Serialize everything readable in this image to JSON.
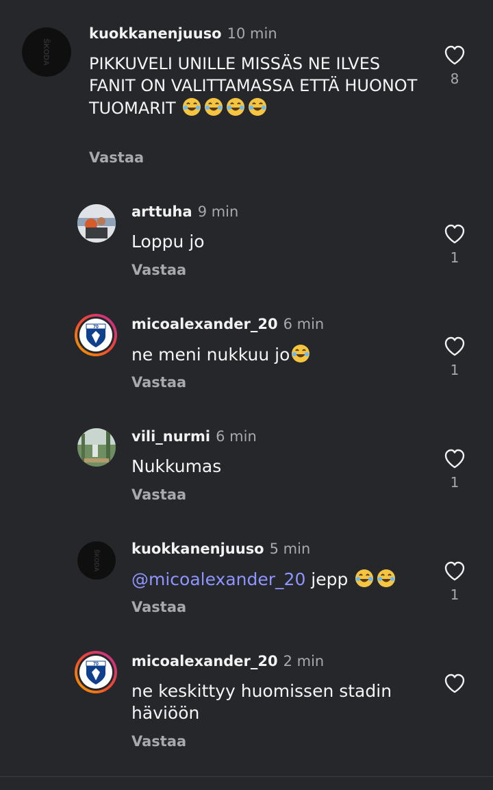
{
  "comments": [
    {
      "username": "kuokkanenjuuso",
      "time": "10 min",
      "text": "PIKKUVELI UNILLE MISSÄS NE ILVES FANIT ON VALITTAMASSA ETTÄ HUONOT TUOMARIT",
      "emoji": "😂😂😂😂",
      "reply": "Vastaa",
      "likes": "8",
      "avatar_text": "ŠKODA"
    },
    {
      "username": "arttuha",
      "time": "9 min",
      "text": "Loppu jo",
      "reply": "Vastaa",
      "likes": "1"
    },
    {
      "username": "micoalexander_20",
      "time": "6 min",
      "text": "ne meni nukkuu jo",
      "emoji": "😂",
      "reply": "Vastaa",
      "likes": "1",
      "avatar_text": "70"
    },
    {
      "username": "vili_nurmi",
      "time": "6 min",
      "text": "Nukkumas",
      "reply": "Vastaa",
      "likes": "1"
    },
    {
      "username": "kuokkanenjuuso",
      "time": "5 min",
      "mention": "@micoalexander_20",
      "text": " jepp ",
      "emoji": "😂😂",
      "reply": "Vastaa",
      "likes": "1",
      "avatar_text": "ŠKODA"
    },
    {
      "username": "micoalexander_20",
      "time": "2 min",
      "text": "ne  keskittyy huomissen stadin häviöön",
      "reply": "Vastaa",
      "avatar_text": "70"
    }
  ],
  "colors": {
    "background": "#25272b",
    "mention": "#8f95ff",
    "secondary_text": "#a7a9ad"
  }
}
